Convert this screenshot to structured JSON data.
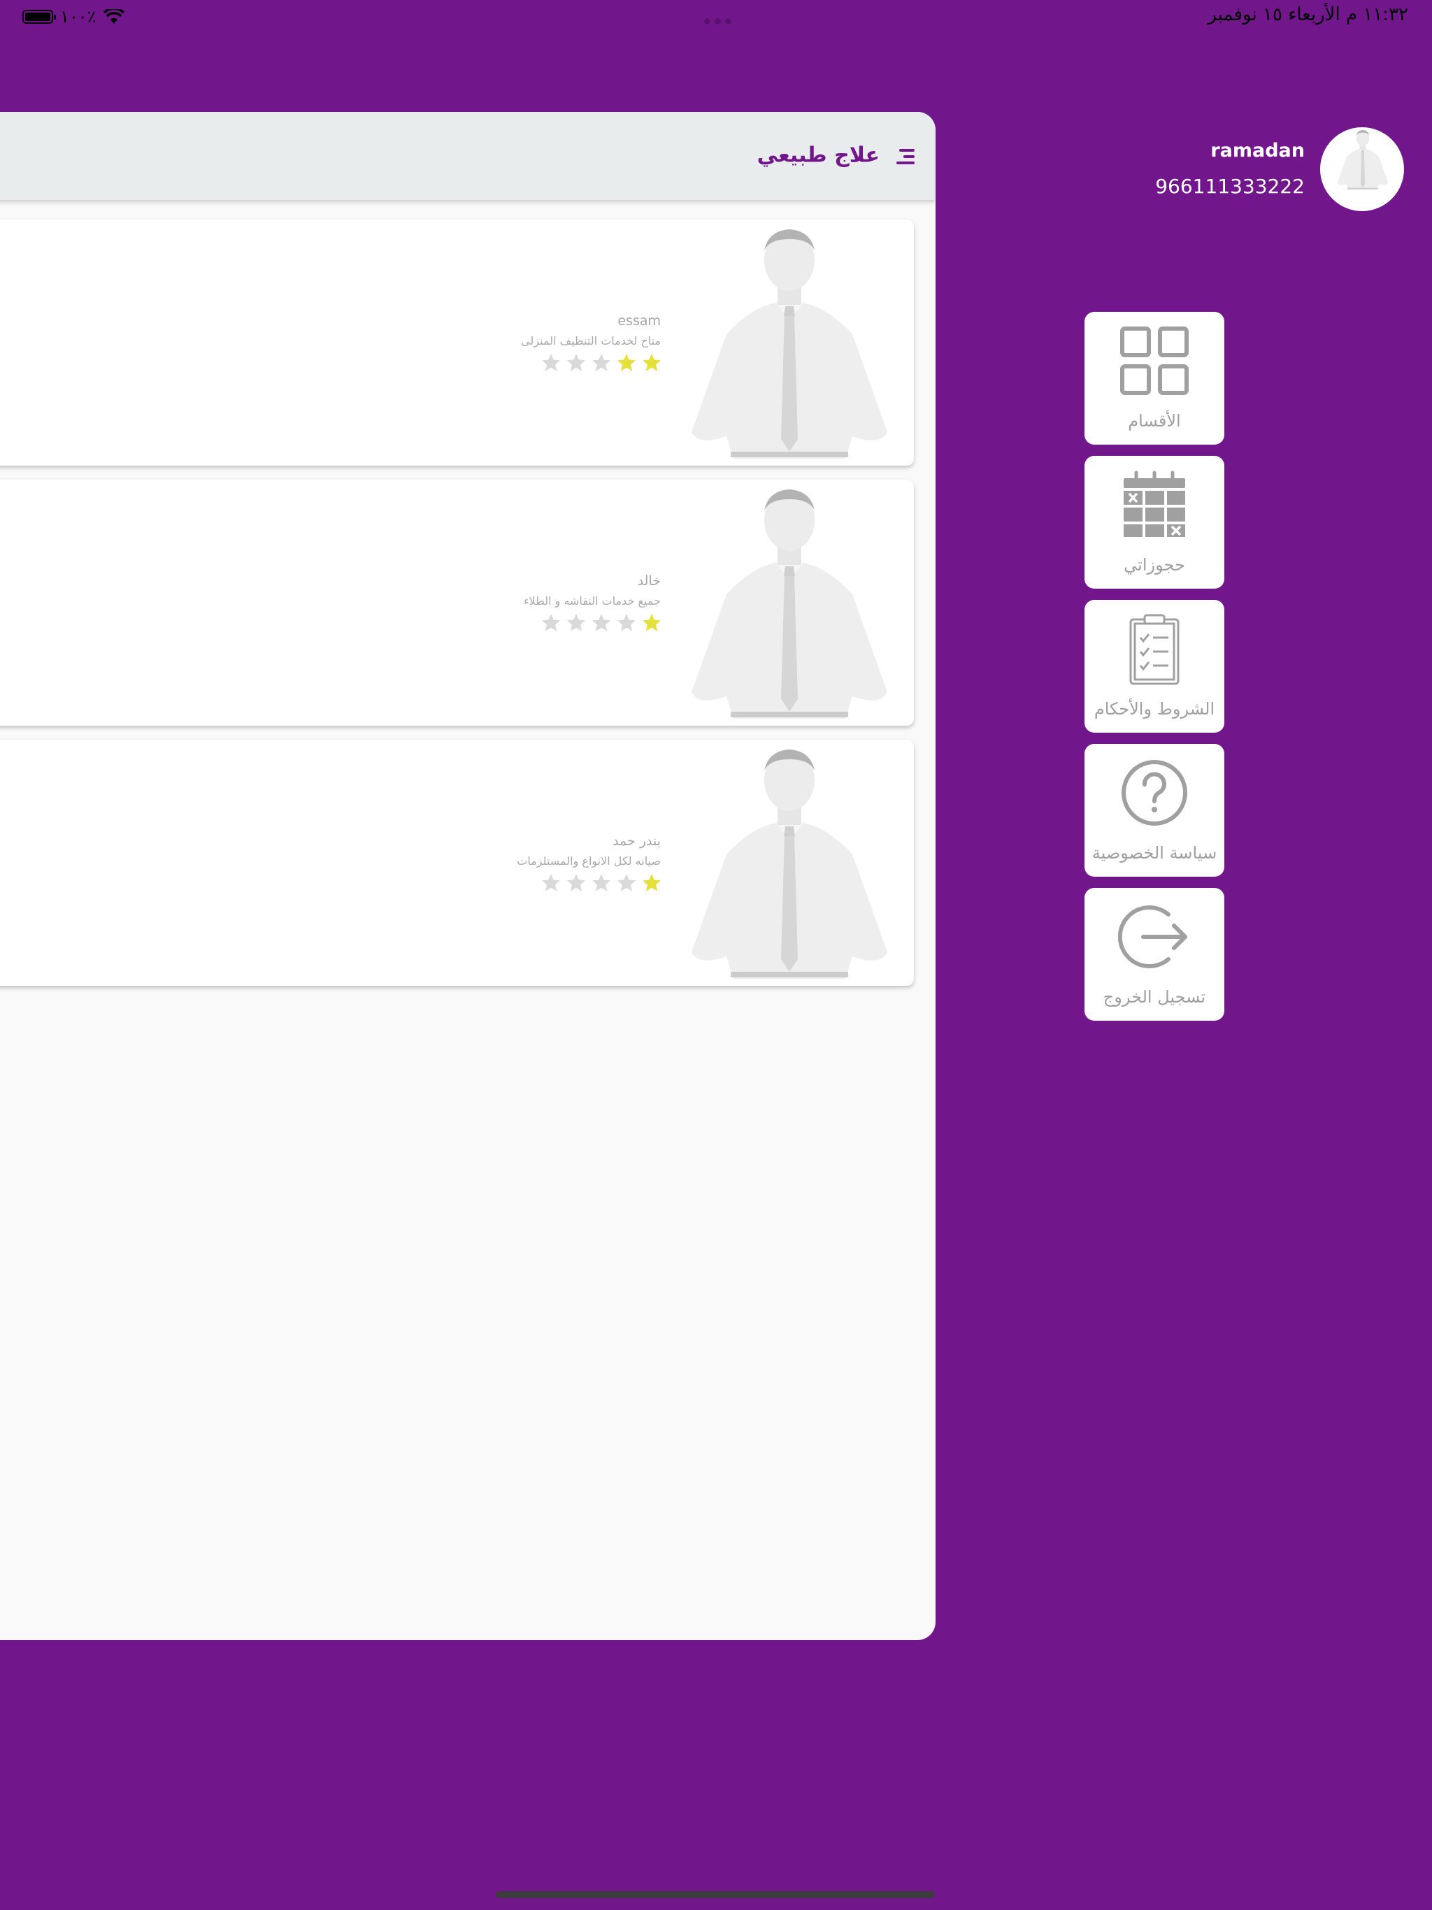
{
  "status_bar": {
    "time_date": "١١:٣٢ م   الأربعاء ١٥ نوفمبر",
    "battery": "١٠٠٪"
  },
  "header": {
    "title": "علاج طبيعي"
  },
  "providers": [
    {
      "name": "essam",
      "description": "متاح لخدمات التنظيف المنزلى",
      "rating": 2
    },
    {
      "name": "خالد",
      "description": "جميع خدمات النقاشه و الطلاء",
      "rating": 1
    },
    {
      "name": "بندر حمد",
      "description": "صيانه لكل الانواع والمستلزمات",
      "rating": 1
    }
  ],
  "user": {
    "name": "ramadan",
    "phone": "966111333222"
  },
  "menu": [
    {
      "label": "الأقسام",
      "icon": "grid-icon"
    },
    {
      "label": "حجوزاتي",
      "icon": "calendar-icon"
    },
    {
      "label": "الشروط والأحكام",
      "icon": "clipboard-icon"
    },
    {
      "label": "سياسة الخصوصية",
      "icon": "question-icon"
    },
    {
      "label": "تسجيل الخروج",
      "icon": "logout-icon"
    }
  ],
  "colors": {
    "brand": "#72168b",
    "star_filled": "#e6e03a",
    "star_empty": "#d9d9d9",
    "icon_gray": "#a0a0a0"
  }
}
